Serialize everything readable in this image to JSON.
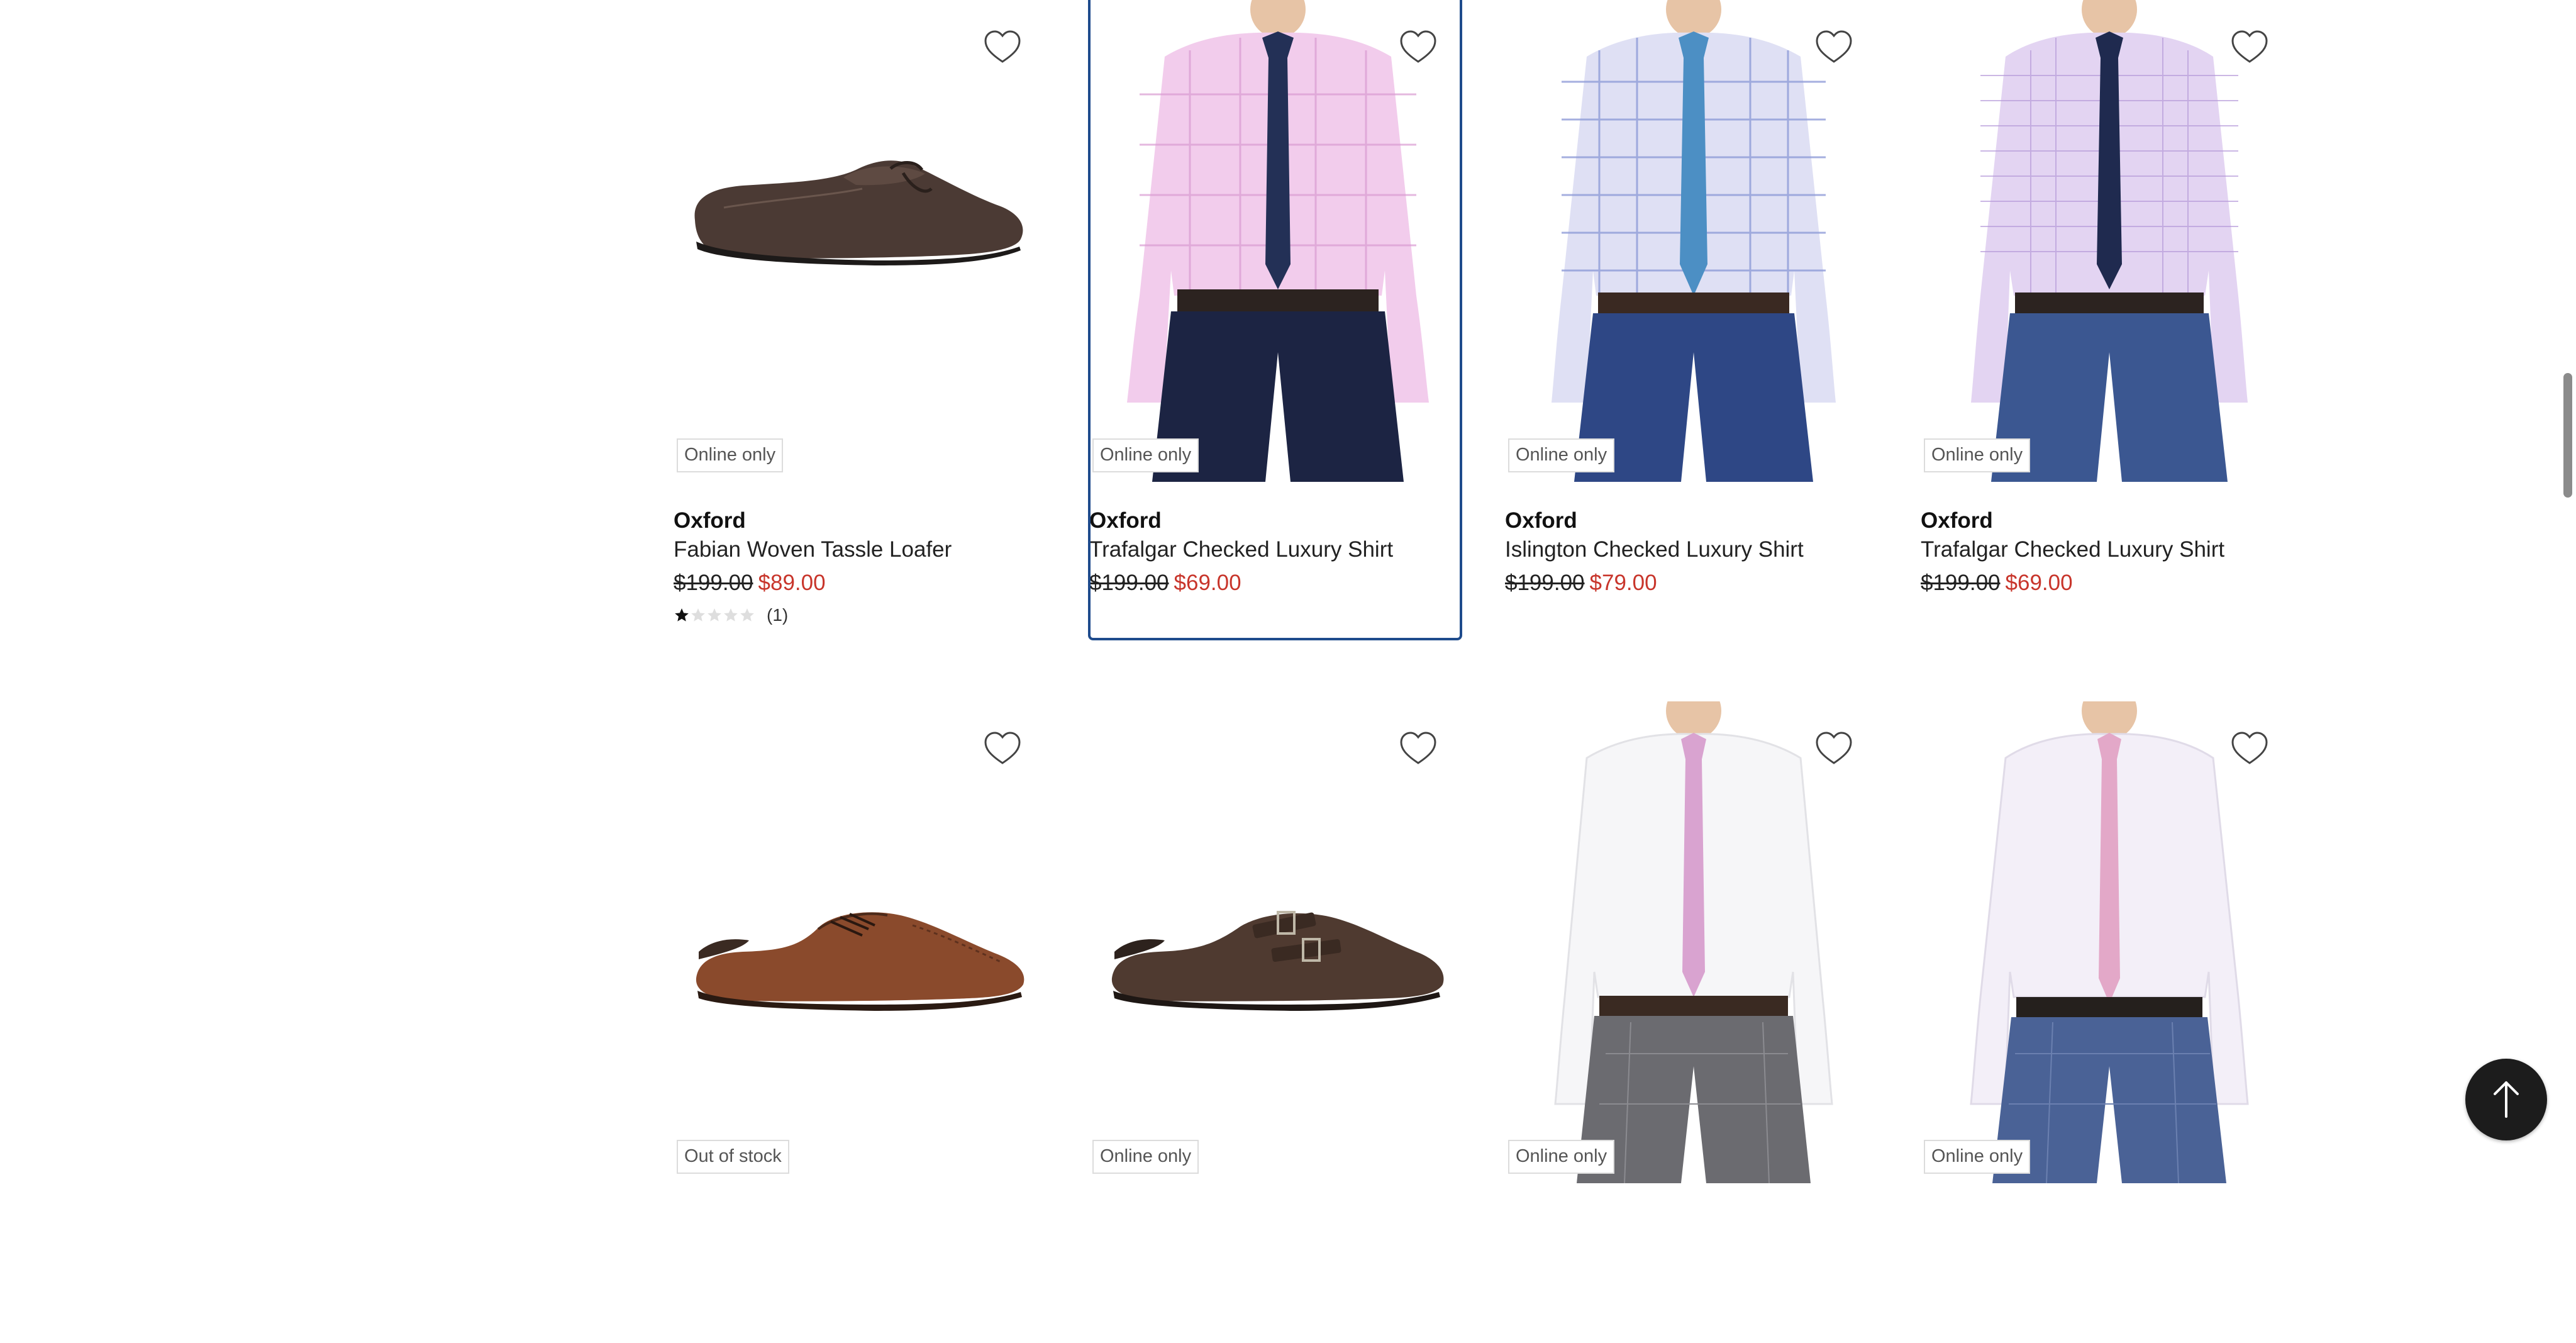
{
  "products": [
    {
      "badge": "Online only",
      "brand": "Oxford",
      "name": "Fabian Woven Tassle Loafer",
      "was_price": "$199.00",
      "now_price": "$89.00",
      "image": "loafer-dark-brown",
      "rating": {
        "value": 1,
        "max": 5,
        "count": "(1)"
      }
    },
    {
      "badge": "Online only",
      "brand": "Oxford",
      "name": "Trafalgar Checked Luxury Shirt",
      "was_price": "$199.00",
      "now_price": "$69.00",
      "image": "shirt-pink-check-navy-tie",
      "focused": true
    },
    {
      "badge": "Online only",
      "brand": "Oxford",
      "name": "Islington Checked Luxury Shirt",
      "was_price": "$199.00",
      "now_price": "$79.00",
      "image": "shirt-blue-check-blue-tie"
    },
    {
      "badge": "Online only",
      "brand": "Oxford",
      "name": "Trafalgar Checked Luxury Shirt",
      "was_price": "$199.00",
      "now_price": "$69.00",
      "image": "shirt-purple-check-navy-tie"
    },
    {
      "badge": "Out of stock",
      "image": "derby-shoe-tan"
    },
    {
      "badge": "Online only",
      "image": "monk-strap-shoe-brown"
    },
    {
      "badge": "Online only",
      "image": "shirt-white-pink-tie-grey-pants"
    },
    {
      "badge": "Online only",
      "image": "shirt-white-pink-tie-blue-pants"
    }
  ],
  "icons": {
    "wishlist": "heart-outline-icon",
    "back_to_top": "arrow-up-icon"
  },
  "colors": {
    "sale_price": "#c8352b",
    "focus_outline": "#1e4b8c",
    "back_to_top_bg": "#1c1c1c"
  }
}
